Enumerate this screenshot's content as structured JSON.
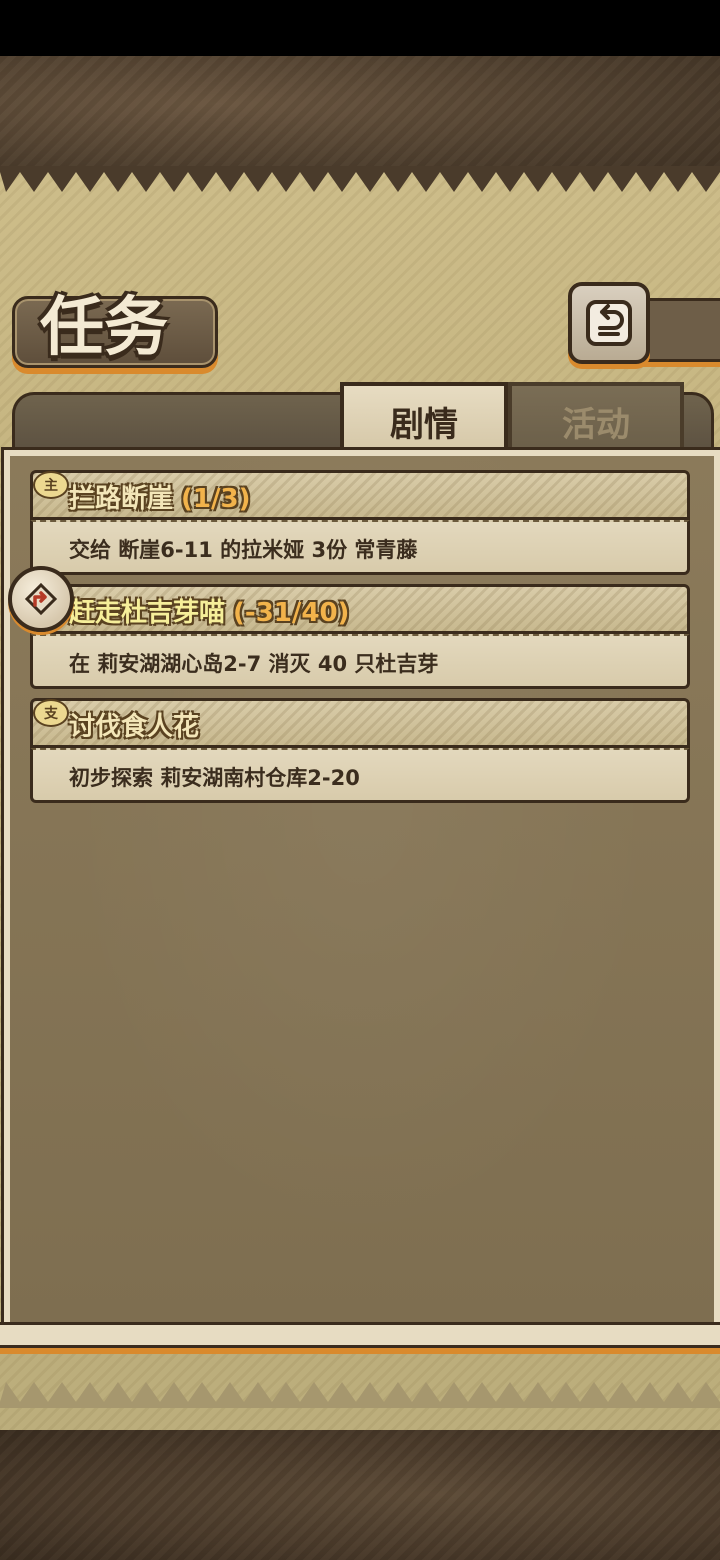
{
  "header": {
    "title": "任务",
    "back_icon": "back-arrow-icon"
  },
  "tabs": [
    {
      "label": "剧情",
      "active": true
    },
    {
      "label": "活动",
      "active": false
    }
  ],
  "quests": [
    {
      "badge": "主",
      "title": "拦路断崖",
      "progress": "(1/3)",
      "description": "交给 断崖6-11 的拉米娅 3份 常青藤",
      "pinned": false
    },
    {
      "badge": "",
      "title": "赶走杜吉芽喵",
      "progress": "(-31/40)",
      "description": "在 莉安湖湖心岛2-7 消灭 40 只杜吉芽",
      "pinned": true
    },
    {
      "badge": "支",
      "title": "讨伐食人花",
      "progress": "",
      "description": "初步探索 莉安湖南村仓库2-20",
      "pinned": false
    }
  ],
  "colors": {
    "accent_orange": "#d98a2d",
    "frame_dark": "#3a2b1c",
    "parchment": "#e7dcc2",
    "title_yellow": "#f3e6b8",
    "progress_orange": "#f2b34b"
  }
}
